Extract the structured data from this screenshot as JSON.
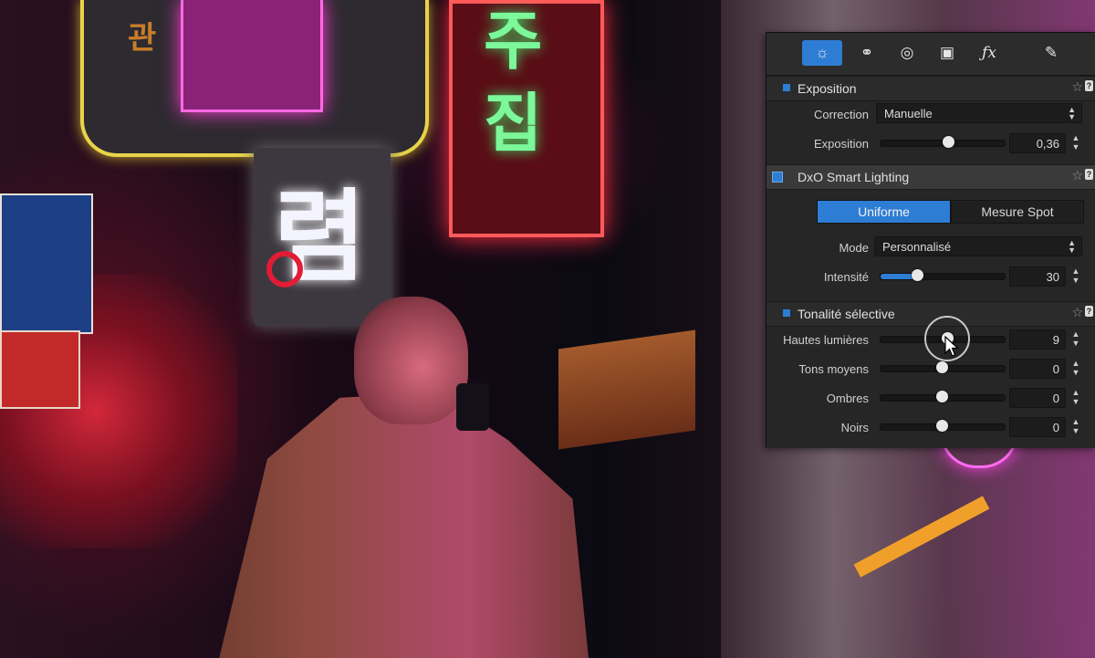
{
  "background": {
    "sign_left_text": "관",
    "sign_green_text": "주\n집",
    "sign_white_text": "렴"
  },
  "toolbar": {
    "tabs": [
      {
        "name": "light-icon",
        "glyph": "☼"
      },
      {
        "name": "color-icon",
        "glyph": "⚭"
      },
      {
        "name": "detail-icon",
        "glyph": "◎"
      },
      {
        "name": "geometry-icon",
        "glyph": "▣"
      },
      {
        "name": "effects-icon",
        "glyph": "ƒx"
      },
      {
        "name": "local-adjust-icon",
        "glyph": "✎"
      }
    ]
  },
  "exposition": {
    "title": "Exposition",
    "correction_label": "Correction",
    "correction_value": "Manuelle",
    "exposure_label": "Exposition",
    "exposure_value": "0,36",
    "exposure_level": 0.55
  },
  "smart_lighting": {
    "title": "DxO Smart Lighting",
    "uniform_label": "Uniforme",
    "spot_label": "Mesure Spot",
    "mode_label": "Mode",
    "mode_value": "Personnalisé",
    "intensity_label": "Intensité",
    "intensity_value": "30",
    "intensity_level": 0.3
  },
  "selective_tone": {
    "title": "Tonalité sélective",
    "rows": [
      {
        "label": "Hautes lumières",
        "value": "9",
        "level": 0.545
      },
      {
        "label": "Tons moyens",
        "value": "0",
        "level": 0.5
      },
      {
        "label": "Ombres",
        "value": "0",
        "level": 0.5
      },
      {
        "label": "Noirs",
        "value": "0",
        "level": 0.5
      }
    ]
  },
  "colors": {
    "accent": "#2e7dd4",
    "panel_bg": "#262626"
  }
}
